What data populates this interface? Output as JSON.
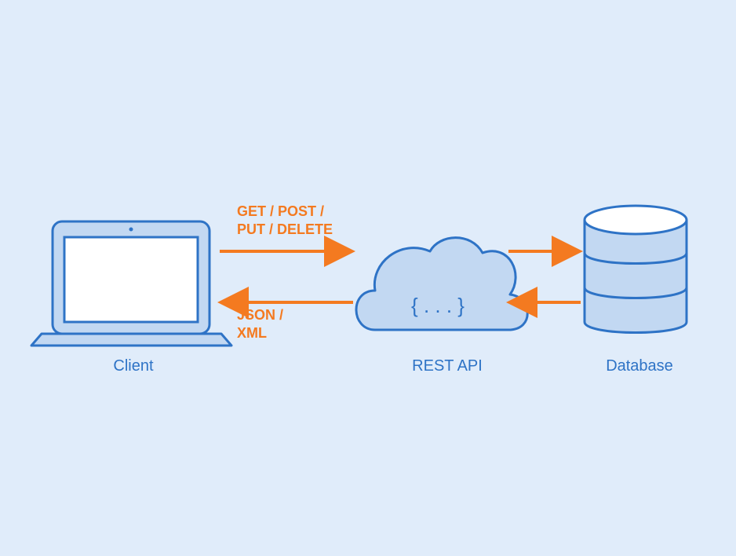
{
  "nodes": {
    "client": {
      "label": "Client"
    },
    "api": {
      "label": "REST API"
    },
    "database": {
      "label": "Database"
    }
  },
  "arrows": {
    "request_methods": {
      "line1": "GET / POST /",
      "line2": "PUT / DELETE"
    },
    "response_formats": {
      "line1": "JSON /",
      "line2": "XML"
    }
  },
  "cloud_braces": "{ . . . }",
  "colors": {
    "background": "#e0ecfa",
    "stroke_blue": "#2e73c6",
    "fill_blue": "#c2d8f2",
    "fill_white": "#ffffff",
    "orange": "#f47a20"
  }
}
